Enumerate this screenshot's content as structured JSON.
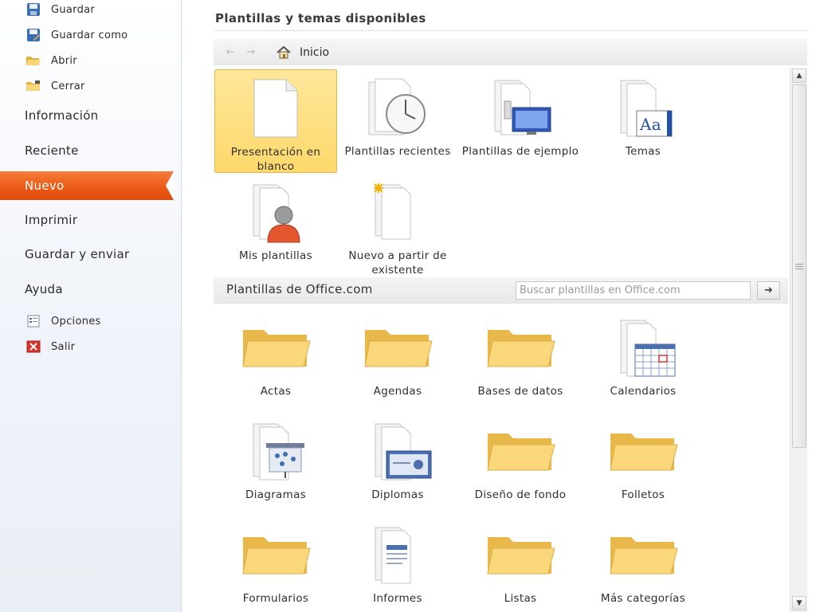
{
  "sidebar": {
    "top_items": [
      {
        "label": "Guardar",
        "icon": "save-icon"
      },
      {
        "label": "Guardar como",
        "icon": "save-as-icon"
      },
      {
        "label": "Abrir",
        "icon": "open-folder-icon"
      },
      {
        "label": "Cerrar",
        "icon": "close-folder-icon"
      }
    ],
    "main_items": [
      {
        "label": "Información"
      },
      {
        "label": "Reciente"
      },
      {
        "label": "Nuevo",
        "active": true
      },
      {
        "label": "Imprimir"
      },
      {
        "label": "Guardar y enviar"
      },
      {
        "label": "Ayuda"
      }
    ],
    "bottom_items": [
      {
        "label": "Opciones",
        "icon": "options-icon"
      },
      {
        "label": "Salir",
        "icon": "exit-icon"
      }
    ],
    "active_color": "#E8590F"
  },
  "main": {
    "title": "Plantillas y temas disponibles",
    "nav": {
      "home_label": "Inicio"
    },
    "available": [
      {
        "label": "Presentación en blanco",
        "icon": "blank-document-icon",
        "selected": true
      },
      {
        "label": "Plantillas recientes",
        "icon": "clock-icon"
      },
      {
        "label": "Plantillas de ejemplo",
        "icon": "sample-templates-icon"
      },
      {
        "label": "Temas",
        "icon": "themes-icon"
      },
      {
        "label": "Mis plantillas",
        "icon": "user-template-icon"
      },
      {
        "label": "Nuevo a partir de existente",
        "icon": "new-from-existing-icon"
      }
    ],
    "office": {
      "title": "Plantillas de Office.com",
      "search_placeholder": "Buscar plantillas en Office.com",
      "search_value": "",
      "categories": [
        {
          "label": "Actas",
          "icon": "folder-icon"
        },
        {
          "label": "Agendas",
          "icon": "folder-icon"
        },
        {
          "label": "Bases de datos",
          "icon": "folder-icon"
        },
        {
          "label": "Calendarios",
          "icon": "calendar-icon"
        },
        {
          "label": "Diagramas",
          "icon": "diagram-icon"
        },
        {
          "label": "Diplomas",
          "icon": "diploma-icon"
        },
        {
          "label": "Diseño de fondo",
          "icon": "folder-icon"
        },
        {
          "label": "Folletos",
          "icon": "folder-icon"
        },
        {
          "label": "Formularios",
          "icon": "folder-icon"
        },
        {
          "label": "Informes",
          "icon": "report-icon"
        },
        {
          "label": "Listas",
          "icon": "folder-icon"
        },
        {
          "label": "Más categorías",
          "icon": "folder-icon"
        }
      ]
    }
  }
}
